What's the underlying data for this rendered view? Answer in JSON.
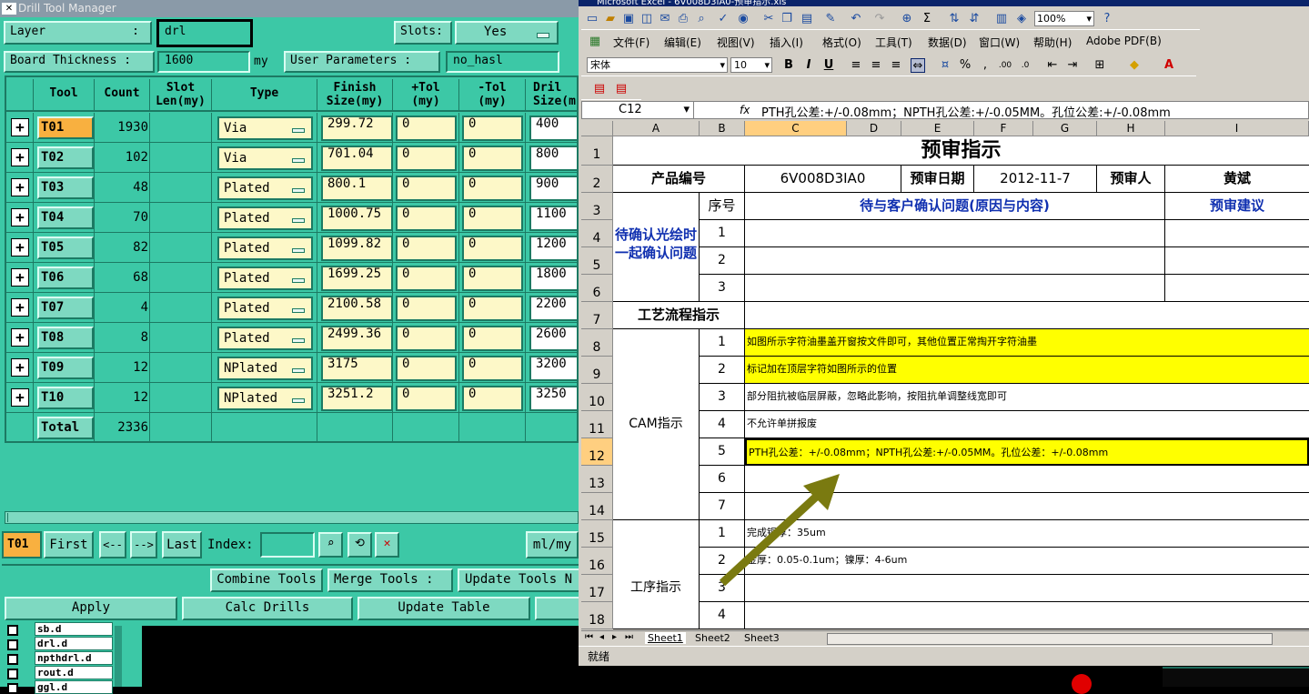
{
  "dtm": {
    "title": "Drill Tool Manager",
    "layer_label": "Layer",
    "layer_colon": ":",
    "layer_value": "drl",
    "slots_label": "Slots:",
    "slots_value": "Yes",
    "board_thickness_label": "Board Thickness :",
    "board_thickness_value": "1600",
    "board_thickness_unit": "my",
    "user_params_label": "User Parameters :",
    "user_params_value": "no_hasl",
    "columns": [
      "Tool",
      "Count",
      "Slot\nLen(my)",
      "Type",
      "Finish\nSize(my)",
      "+Tol\n(my)",
      "-Tol\n(my)",
      "Dril\nSize(m"
    ],
    "rows": [
      {
        "tool": "T01",
        "count": "1930",
        "type": "Via",
        "finish": "299.72",
        "ptol": "0",
        "mtol": "0",
        "drill": "400"
      },
      {
        "tool": "T02",
        "count": "102",
        "type": "Via",
        "finish": "701.04",
        "ptol": "0",
        "mtol": "0",
        "drill": "800"
      },
      {
        "tool": "T03",
        "count": "48",
        "type": "Plated",
        "finish": "800.1",
        "ptol": "0",
        "mtol": "0",
        "drill": "900"
      },
      {
        "tool": "T04",
        "count": "70",
        "type": "Plated",
        "finish": "1000.75",
        "ptol": "0",
        "mtol": "0",
        "drill": "1100"
      },
      {
        "tool": "T05",
        "count": "82",
        "type": "Plated",
        "finish": "1099.82",
        "ptol": "0",
        "mtol": "0",
        "drill": "1200"
      },
      {
        "tool": "T06",
        "count": "68",
        "type": "Plated",
        "finish": "1699.25",
        "ptol": "0",
        "mtol": "0",
        "drill": "1800"
      },
      {
        "tool": "T07",
        "count": "4",
        "type": "Plated",
        "finish": "2100.58",
        "ptol": "0",
        "mtol": "0",
        "drill": "2200"
      },
      {
        "tool": "T08",
        "count": "8",
        "type": "Plated",
        "finish": "2499.36",
        "ptol": "0",
        "mtol": "0",
        "drill": "2600"
      },
      {
        "tool": "T09",
        "count": "12",
        "type": "NPlated",
        "finish": "3175",
        "ptol": "0",
        "mtol": "0",
        "drill": "3200"
      },
      {
        "tool": "T10",
        "count": "12",
        "type": "NPlated",
        "finish": "3251.2",
        "ptol": "0",
        "mtol": "0",
        "drill": "3250"
      }
    ],
    "total_label": "Total",
    "total_value": "2336",
    "current_tool": "T01",
    "nav": {
      "first": "First",
      "prev": "<--",
      "next": "-->",
      "last": "Last",
      "index_label": "Index:",
      "unit": "ml/my"
    },
    "combine_tools": "Combine Tools",
    "merge_tools": "Merge Tools :",
    "update_tools": "Update Tools N",
    "apply": "Apply",
    "calc_drills": "Calc Drills",
    "update_table": "Update Table"
  },
  "layers": [
    "sb.d",
    "drl.d",
    "npthdrl.d",
    "rout.d",
    "ggl.d"
  ],
  "excel": {
    "title": "Microsoft Excel - 6V008D3IA0-预审指示.xls",
    "menus": [
      "文件(F)",
      "编辑(E)",
      "视图(V)",
      "插入(I)",
      "格式(O)",
      "工具(T)",
      "数据(D)",
      "窗口(W)",
      "帮助(H)",
      "Adobe PDF(B)"
    ],
    "font_name": "宋体",
    "font_size": "10",
    "zoom": "100%",
    "name_box": "C12",
    "fx": "fx",
    "formula": "PTH孔公差:+/-0.08mm；NPTH孔公差:+/-0.05MM。孔位公差:+/-0.08mm",
    "columns": [
      "A",
      "B",
      "C",
      "D",
      "E",
      "F",
      "G",
      "H",
      "I"
    ],
    "row_numbers": [
      "1",
      "2",
      "3",
      "4",
      "5",
      "6",
      "7",
      "8",
      "9",
      "10",
      "11",
      "12",
      "13",
      "14",
      "15",
      "16",
      "17",
      "18"
    ],
    "sheet_title": "预审指示",
    "product_label": "产品编号",
    "product_value": "6V008D3IA0",
    "date_label": "预审日期",
    "date_value": "2012-11-7",
    "reviewer_label": "预审人",
    "reviewer_value": "黄斌",
    "confirm_section": "待确认光绘时一起确认问题",
    "seq_label": "序号",
    "confirm_header": "待与客户确认问题(原因与内容)",
    "suggest_header": "预审建议",
    "confirm_seq": [
      "1",
      "2",
      "3"
    ],
    "process_label": "工艺流程指示",
    "cam_label": "CAM指示",
    "cam_items": [
      {
        "n": "1",
        "text": "如图所示字符油墨盖开窗按文件即可，其他位置正常掏开字符油墨"
      },
      {
        "n": "2",
        "text": "标记加在顶层字符如图所示的位置"
      },
      {
        "n": "3",
        "text": "部分阻抗被临层屏蔽，忽略此影响，按阻抗单调整线宽即可"
      },
      {
        "n": "4",
        "text": "不允许单拼报废"
      },
      {
        "n": "5",
        "text": "PTH孔公差：+/-0.08mm；NPTH孔公差:+/-0.05MM。孔位公差：+/-0.08mm"
      },
      {
        "n": "6",
        "text": ""
      },
      {
        "n": "7",
        "text": ""
      }
    ],
    "proc_label": "工序指示",
    "proc_items": [
      {
        "n": "1",
        "text": "完成铜厚：35um"
      },
      {
        "n": "2",
        "text": "金厚：0.05-0.1um；镍厚：4-6um"
      },
      {
        "n": "3",
        "text": ""
      },
      {
        "n": "4",
        "text": ""
      }
    ],
    "sheets": [
      "Sheet1",
      "Sheet2",
      "Sheet3"
    ],
    "status": "就绪"
  },
  "colors": {
    "dtm_bg": "#3cc8a6",
    "accent": "#f8b040",
    "highlight": "#ffff00",
    "arrow": "#7a7a10"
  }
}
